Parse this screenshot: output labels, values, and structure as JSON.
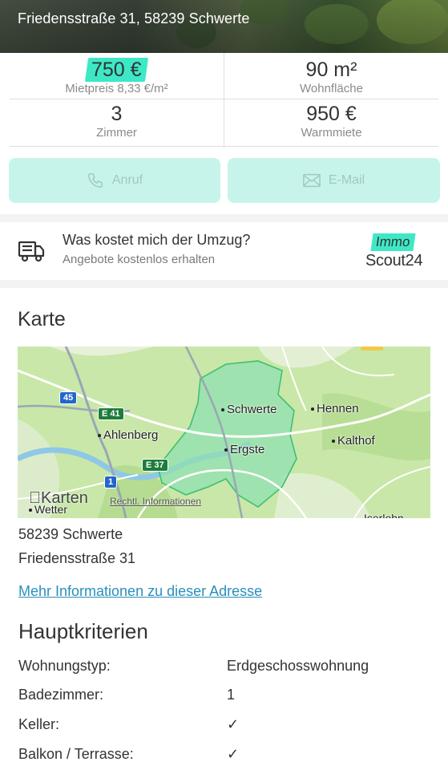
{
  "listing": {
    "address": "Friedensstraße 31, 58239 Schwerte"
  },
  "facts": {
    "rent_value": "750 €",
    "rent_label": "Mietpreis 8,33 €/m²",
    "area_value": "90 m²",
    "area_label": "Wohnfläche",
    "rooms_value": "3",
    "rooms_label": "Zimmer",
    "warm_value": "950 €",
    "warm_label": "Warmmiete"
  },
  "contact": {
    "call_label": "Anruf",
    "mail_label": "E-Mail"
  },
  "moving": {
    "title": "Was kostet mich der Umzug?",
    "subtitle": "Angebote kostenlos erhalten",
    "logo_top": "Immo",
    "logo_bottom": "Scout24"
  },
  "map_section": {
    "heading": "Karte",
    "places": [
      "Schwerte",
      "Hennen",
      "Ahlenberg",
      "Ergste",
      "Kalthof",
      "Wetter",
      "Iserlohn"
    ],
    "road_signs": [
      "45",
      "E 41",
      "E 37",
      "1"
    ],
    "provider": "Karten",
    "legal": "Rechtl. Informationen"
  },
  "address_block": {
    "line1": "58239 Schwerte",
    "line2": "Friedensstraße 31",
    "link": "Mehr Informationen zu dieser Adresse"
  },
  "criteria": {
    "heading": "Hauptkriterien",
    "rows": [
      {
        "key": "Wohnungstyp:",
        "value": "Erdgeschosswohnung"
      },
      {
        "key": "Badezimmer:",
        "value": "1"
      },
      {
        "key": "Keller:",
        "value": "✓"
      },
      {
        "key": "Balkon / Terrasse:",
        "value": "✓"
      }
    ]
  },
  "colors": {
    "accent": "#3ee8c6",
    "button_bg": "#c6f4eb",
    "link": "#2a8fbd"
  }
}
